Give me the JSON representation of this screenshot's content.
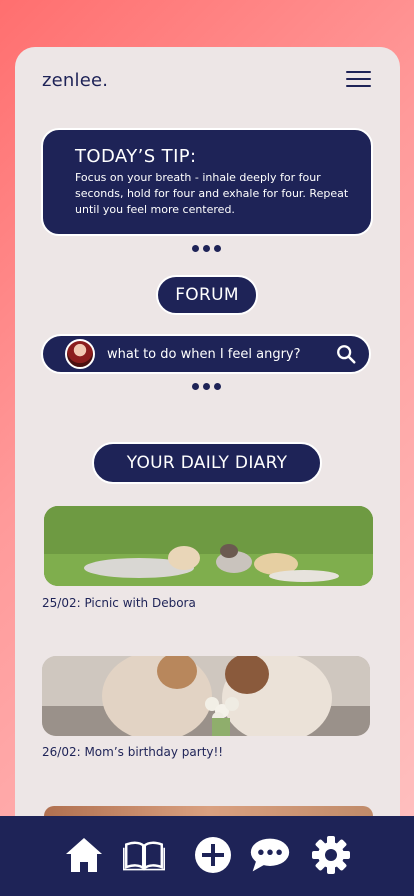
{
  "header": {
    "brand": "zenlee.",
    "menu_icon": "hamburger-menu-icon"
  },
  "tip": {
    "title": "TODAY’S TIP:",
    "body": "Focus on your breath - inhale deeply for four seconds, hold for four and exhale for four. Repeat until you feel more centered."
  },
  "forum": {
    "label": "FORUM",
    "search_text": "what to do when I feel angry?",
    "search_icon": "search-icon"
  },
  "diary": {
    "label": "YOUR DAILY DIARY",
    "entries": [
      {
        "caption": "25/02: Picnic with Debora"
      },
      {
        "caption": "26/02: Mom’s birthday party!!"
      }
    ]
  },
  "nav": {
    "items": [
      "home-icon",
      "book-icon",
      "add-icon",
      "chat-icon",
      "settings-icon"
    ]
  },
  "colors": {
    "navy": "#1e2357",
    "card": "#ede6e6",
    "accent_gradient_start": "#ff6f6f"
  }
}
